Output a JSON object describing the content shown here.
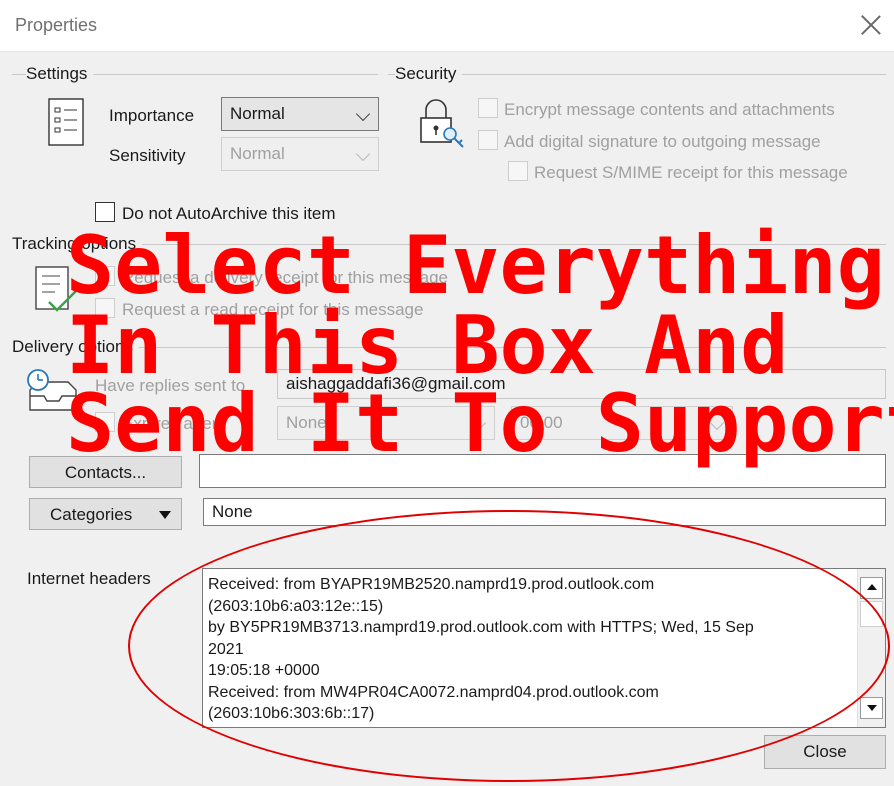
{
  "window": {
    "title": "Properties"
  },
  "settings": {
    "title": "Settings",
    "importance_label": "Importance",
    "importance_value": "Normal",
    "sensitivity_label": "Sensitivity",
    "sensitivity_value": "Normal",
    "no_autoarchive": "Do not AutoArchive this item"
  },
  "security": {
    "title": "Security",
    "encrypt": "Encrypt message contents and attachments",
    "signature": "Add digital signature to outgoing message",
    "smime": "Request S/MIME receipt for this message"
  },
  "tracking": {
    "title": "Tracking options",
    "delivery": "Request a delivery receipt for this message",
    "read": "Request a read receipt for this message"
  },
  "delivery": {
    "title": "Delivery options",
    "replies_label": "Have replies sent to",
    "replies_value": "aishaggaddafi36@gmail.com",
    "expires_label": "Expires after",
    "expires_date": "None",
    "expires_time": "00:00"
  },
  "contacts": {
    "button": "Contacts...",
    "value": ""
  },
  "categories": {
    "button": "Categories",
    "value": "None"
  },
  "internet_headers": {
    "label": "Internet headers",
    "lines": [
      "Received: from BYAPR19MB2520.namprd19.prod.outlook.com",
      "(2603:10b6:a03:12e::15)",
      " by BY5PR19MB3713.namprd19.prod.outlook.com with HTTPS; Wed, 15 Sep",
      "2021",
      " 19:05:18 +0000",
      "Received: from MW4PR04CA0072.namprd04.prod.outlook.com",
      "(2603:10b6:303:6b::17)"
    ]
  },
  "footer": {
    "close": "Close"
  },
  "overlay": {
    "line1": "Select Everything",
    "line2": "In This Box And",
    "line3": "Send It To Support",
    "color": "#ff0000"
  }
}
